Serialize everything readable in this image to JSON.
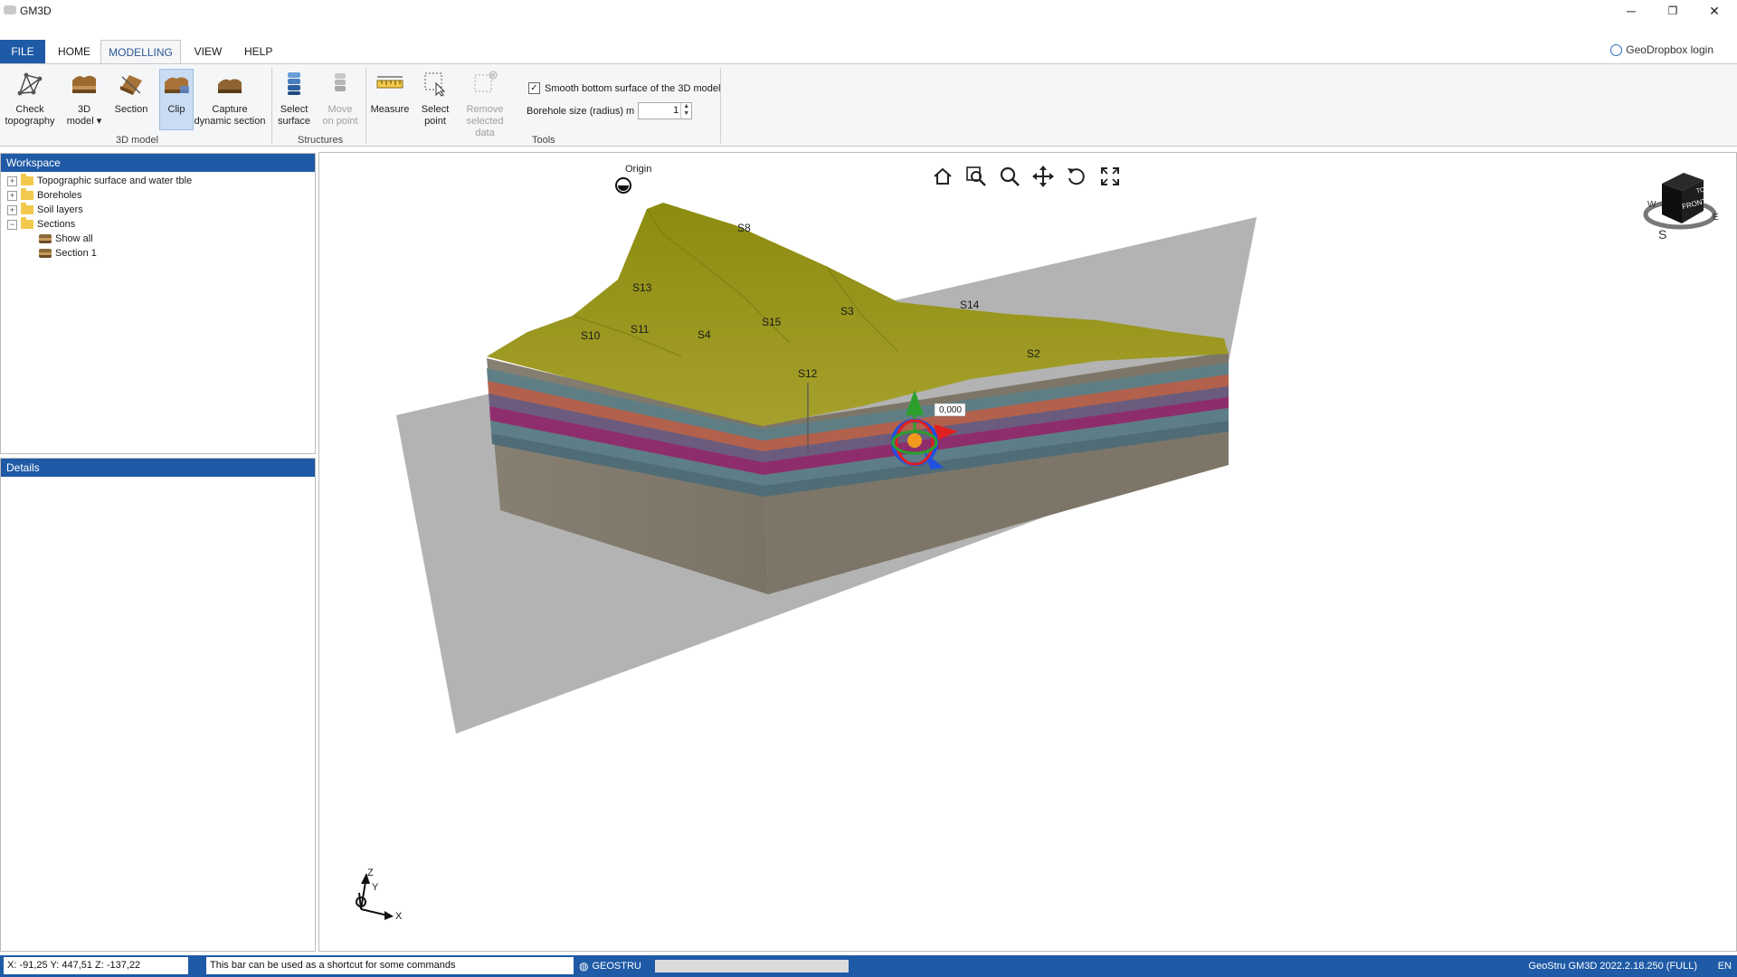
{
  "window": {
    "title": "GM3D",
    "minimize": "─",
    "restore": "❐",
    "close": "✕"
  },
  "menu": {
    "tabs": [
      {
        "label": "FILE"
      },
      {
        "label": "HOME"
      },
      {
        "label": "MODELLING"
      },
      {
        "label": "VIEW"
      },
      {
        "label": "HELP"
      }
    ],
    "active_tab": "MODELLING",
    "login_label": "GeoDropbox login"
  },
  "ribbon": {
    "groups": [
      {
        "label": "3D model"
      },
      {
        "label": "Structures"
      },
      {
        "label": "Tools"
      }
    ],
    "buttons": {
      "check_topography": {
        "line1": "Check",
        "line2": "topography"
      },
      "model_3d": {
        "line1": "3D",
        "line2": "model ▾"
      },
      "section": {
        "line1": "Section"
      },
      "clip": {
        "line1": "Clip"
      },
      "capture": {
        "line1": "Capture",
        "line2": "dynamic section"
      },
      "select_surface": {
        "line1": "Select",
        "line2": "surface"
      },
      "move_on_point": {
        "line1": "Move",
        "line2": "on point"
      },
      "measure": {
        "line1": "Measure"
      },
      "select_point": {
        "line1": "Select",
        "line2": "point"
      },
      "remove_selected": {
        "line1": "Remove",
        "line2": "selected data"
      }
    },
    "smooth_checkbox": {
      "label": "Smooth bottom surface of the 3D model",
      "checked": true,
      "mark": "✓"
    },
    "borehole_size": {
      "label": "Borehole size (radius) m",
      "value": "1"
    }
  },
  "workspace": {
    "header": "Workspace",
    "items": [
      {
        "label": "Topographic surface and water tble",
        "expander": "+"
      },
      {
        "label": "Boreholes",
        "expander": "+"
      },
      {
        "label": "Soil layers",
        "expander": "+"
      },
      {
        "label": "Sections",
        "expander": "−"
      },
      {
        "label": "Show all"
      },
      {
        "label": "Section 1"
      }
    ]
  },
  "details": {
    "header": "Details"
  },
  "viewport": {
    "origin_label": "Origin",
    "gizmo_value": "0,000",
    "boreholes": [
      "S8",
      "S13",
      "S14",
      "S3",
      "S15",
      "S11",
      "S10",
      "S4",
      "S12",
      "S2"
    ],
    "viewcube": {
      "top": "TOP",
      "front": "FRONT",
      "w": "W",
      "e": "E",
      "s": "S"
    },
    "axes": {
      "x": "X",
      "y": "Y",
      "z": "Z"
    }
  },
  "statusbar": {
    "coords": "X: -91,25   Y: 447,51   Z: -137,22",
    "command_hint": "This bar can be used as a shortcut for some commands",
    "brand": "GEOSTRU",
    "version": "GeoStru GM3D 2022.2.18.250 (FULL)",
    "lang": "EN"
  },
  "colors": {
    "accent": "#1f5aa6",
    "terrain": "#8a8a14",
    "plane": "#9e9e9e"
  }
}
